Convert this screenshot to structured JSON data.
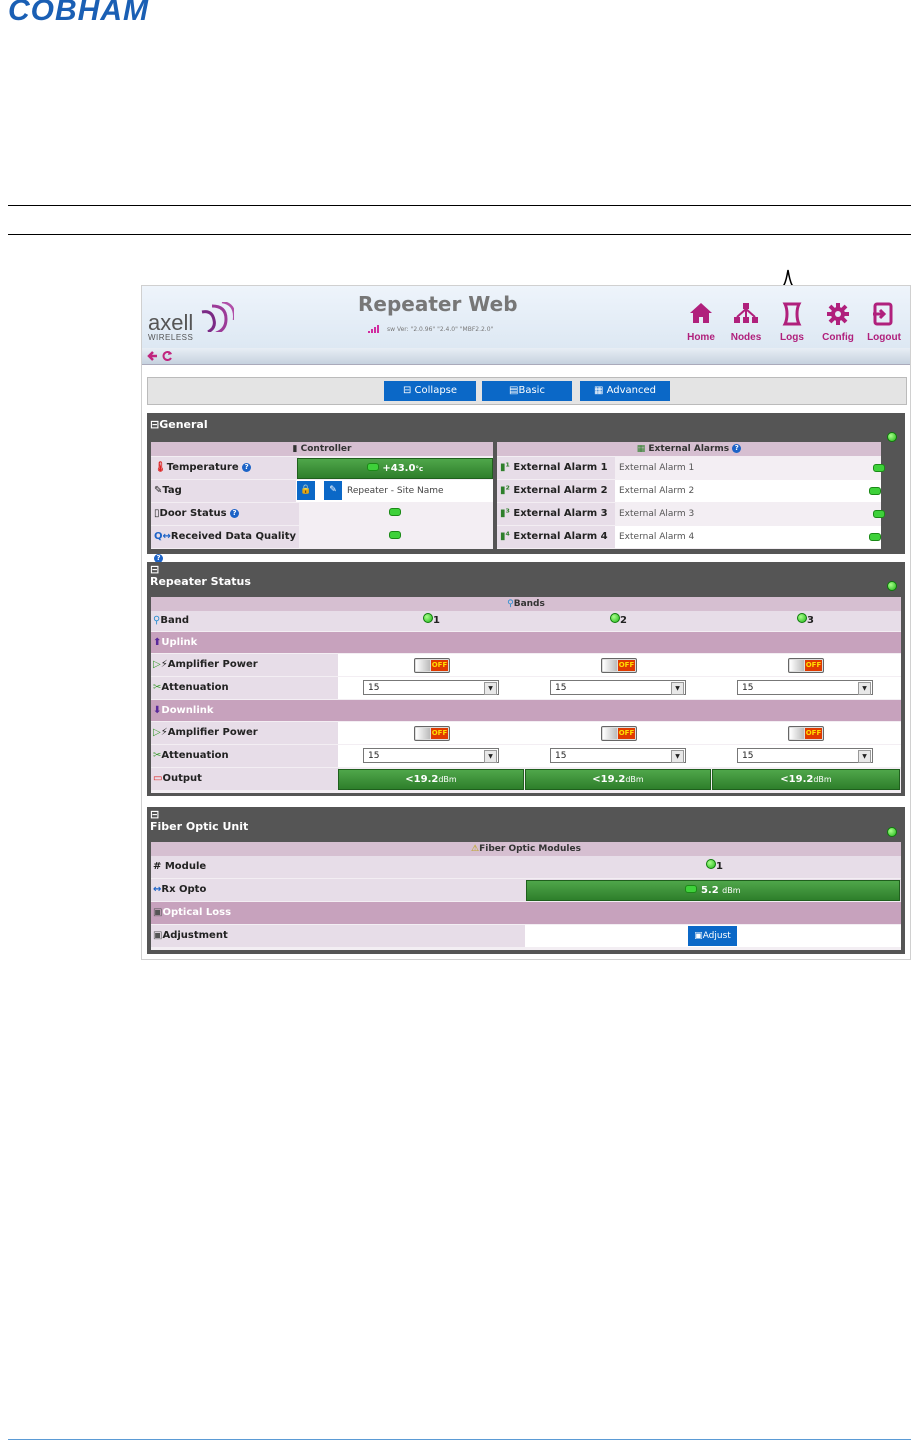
{
  "brand": "COBHAM",
  "app": {
    "logo_main": "axell",
    "logo_sub": "WIRELESS",
    "title": "Repeater Web",
    "version": "sw Ver: \"2.0.96\" \"2.4.0\" \"MBF2.2.0\"",
    "nav": [
      {
        "label": "Home",
        "icon": "home-icon"
      },
      {
        "label": "Nodes",
        "icon": "nodes-icon"
      },
      {
        "label": "Logs",
        "icon": "logs-icon"
      },
      {
        "label": "Config",
        "icon": "gear-icon"
      },
      {
        "label": "Logout",
        "icon": "logout-icon"
      }
    ],
    "toolbar": {
      "collapse": "Collapse",
      "basic": "Basic",
      "advanced": "Advanced"
    }
  },
  "general": {
    "title": "General",
    "controller": {
      "header": "Controller",
      "temperature_label": "Temperature",
      "temperature_value": "+43.0",
      "temperature_unit": "°c",
      "tag_label": "Tag",
      "tag_value": "Repeater - Site Name",
      "door_label": "Door Status",
      "rdq_label": "Received Data Quality"
    },
    "alarms": {
      "header": "External Alarms",
      "items": [
        {
          "label": "External Alarm 1",
          "value": "External Alarm 1"
        },
        {
          "label": "External Alarm 2",
          "value": "External Alarm 2"
        },
        {
          "label": "External Alarm 3",
          "value": "External Alarm 3"
        },
        {
          "label": "External Alarm 4",
          "value": "External Alarm 4"
        }
      ]
    }
  },
  "repeater": {
    "title": "Repeater Status",
    "bands_header": "Bands",
    "band_label": "Band",
    "bands": [
      "1",
      "2",
      "3"
    ],
    "uplink": "Uplink",
    "downlink": "Downlink",
    "amp_label": "Amplifier Power",
    "att_label": "Attenuation",
    "output_label": "Output",
    "toggle_off": "OFF",
    "uplink_att": [
      "15",
      "15",
      "15"
    ],
    "downlink_att": [
      "15",
      "15",
      "15"
    ],
    "outputs": [
      {
        "value": "<19.2",
        "unit": "dBm"
      },
      {
        "value": "<19.2",
        "unit": "dBm"
      },
      {
        "value": "<19.2",
        "unit": "dBm"
      }
    ]
  },
  "fiber": {
    "title": "Fiber Optic Unit",
    "header": "Fiber Optic Modules",
    "module_label": "# Module",
    "module_value": "1",
    "rx_label": "Rx Opto",
    "rx_value": "5.2",
    "rx_unit": "dBm",
    "loss_label": "Optical Loss",
    "adjust_label": "Adjustment",
    "adjust_button": "Adjust"
  }
}
